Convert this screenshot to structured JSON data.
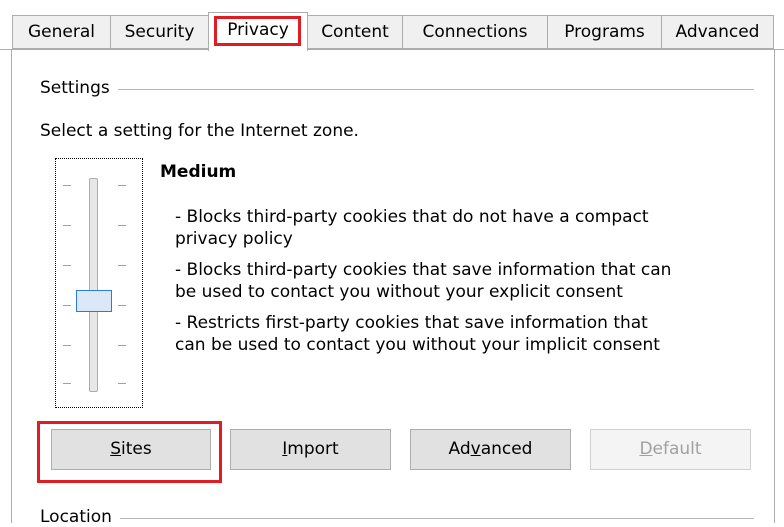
{
  "tabs": [
    {
      "label": "General"
    },
    {
      "label": "Security"
    },
    {
      "label": "Privacy"
    },
    {
      "label": "Content"
    },
    {
      "label": "Connections"
    },
    {
      "label": "Programs"
    },
    {
      "label": "Advanced"
    }
  ],
  "settings": {
    "group_title": "Settings",
    "prompt": "Select a setting for the Internet zone.",
    "level": "Medium",
    "description_lines": [
      "- Blocks third-party cookies that do not have a compact",
      "privacy policy",
      "- Blocks third-party cookies that save information that can",
      "be used to contact you without your explicit consent",
      "- Restricts first-party cookies that save information that",
      "can be used to contact you without your implicit consent"
    ]
  },
  "buttons": {
    "sites": {
      "underline": "S",
      "rest": "ites"
    },
    "import": {
      "underline": "I",
      "rest": "mport"
    },
    "advanced": {
      "pre": "Ad",
      "underline": "v",
      "rest": "anced"
    },
    "default": {
      "underline": "D",
      "rest": "efault"
    }
  },
  "location": {
    "group_title": "Location"
  },
  "colors": {
    "highlight": "#e01c24",
    "slider_thumb_border": "#2c7bd6"
  }
}
